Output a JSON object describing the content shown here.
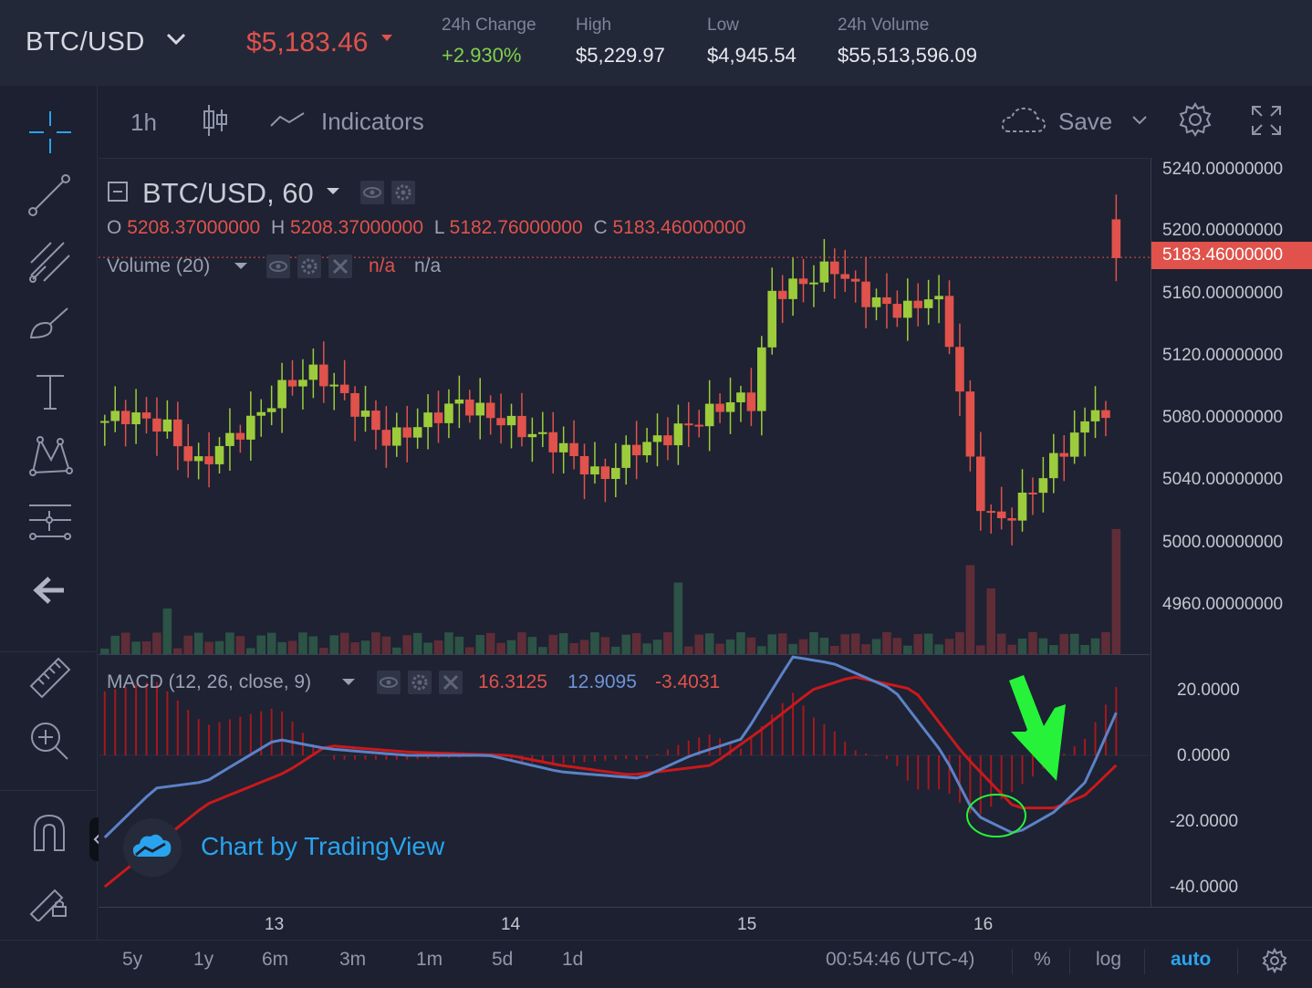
{
  "header": {
    "pair": "BTC/USD",
    "price": "$5,183.46",
    "stats": [
      {
        "label": "24h Change",
        "value": "+2.930%",
        "color": "#7fd14b"
      },
      {
        "label": "High",
        "value": "$5,229.97"
      },
      {
        "label": "Low",
        "value": "$4,945.54"
      },
      {
        "label": "24h Volume",
        "value": "$55,513,596.09"
      }
    ]
  },
  "toolbar": {
    "interval": "1h",
    "indicators_label": "Indicators",
    "save_label": "Save"
  },
  "main_legend": {
    "symbol": "BTC/USD, 60",
    "o_label": "O",
    "o_value": "5208.37000000",
    "h_label": "H",
    "h_value": "5208.37000000",
    "l_label": "L",
    "l_value": "5182.76000000",
    "c_label": "C",
    "c_value": "5183.46000000",
    "volume_label": "Volume (20)",
    "volume_v1": "n/a",
    "volume_v2": "n/a"
  },
  "macd_legend": {
    "label": "MACD (12, 26, close, 9)",
    "v1": "16.3125",
    "v2": "12.9095",
    "v3": "-3.4031"
  },
  "watermark": "Chart by TradingView",
  "price_axis": {
    "labels": [
      "5240.00000000",
      "5200.00000000",
      "5160.00000000",
      "5120.00000000",
      "5080.00000000",
      "5040.00000000",
      "5000.00000000",
      "4960.00000000"
    ],
    "current": "5183.46000000"
  },
  "macd_axis": {
    "labels": [
      "20.0000",
      "0.0000",
      "-20.0000",
      "-40.0000"
    ]
  },
  "time_axis": {
    "labels": [
      "13",
      "14",
      "15",
      "16"
    ]
  },
  "bottom": {
    "ranges": [
      "5y",
      "1y",
      "6m",
      "3m",
      "1m",
      "5d",
      "1d"
    ],
    "clock": "00:54:46 (UTC-4)",
    "percent": "%",
    "log": "log",
    "auto": "auto"
  },
  "colors": {
    "up": "#9ccc3b",
    "down": "#e0524b",
    "macd": "#5c82c8",
    "signal": "#c8191c",
    "annotation": "#27f23a",
    "accent": "#2aa3ee"
  }
}
